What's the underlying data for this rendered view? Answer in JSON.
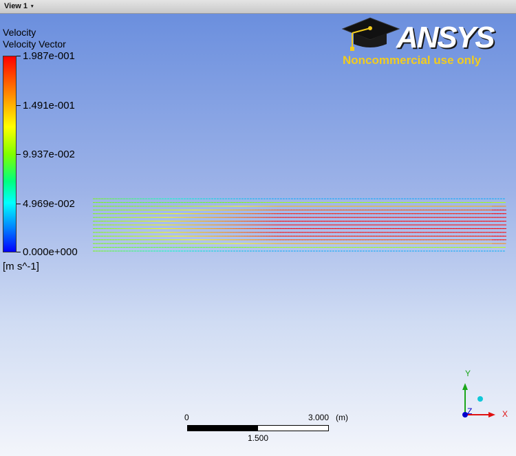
{
  "tab": {
    "label": "View 1",
    "caret": "▾"
  },
  "legend": {
    "title": "Velocity",
    "subtitle": "Velocity Vector",
    "ticks": [
      "1.987e-001",
      "1.491e-001",
      "9.937e-002",
      "4.969e-002",
      "0.000e+000"
    ],
    "units": "[m s^-1]"
  },
  "logo": {
    "brand": "ANSYS",
    "notice": "Noncommercial use only",
    "icon": "graduation-cap-icon"
  },
  "scale": {
    "zero": "0",
    "max": "3.000",
    "unit": "(m)",
    "mid": "1.500"
  },
  "axes": {
    "y": "Y",
    "x": "X",
    "z": "Z"
  },
  "colors": {
    "y_axis": "#1aa61a",
    "x_axis": "#e01010",
    "z_axis": "#0000cc",
    "logo_yellow": "#f2cc1e"
  }
}
